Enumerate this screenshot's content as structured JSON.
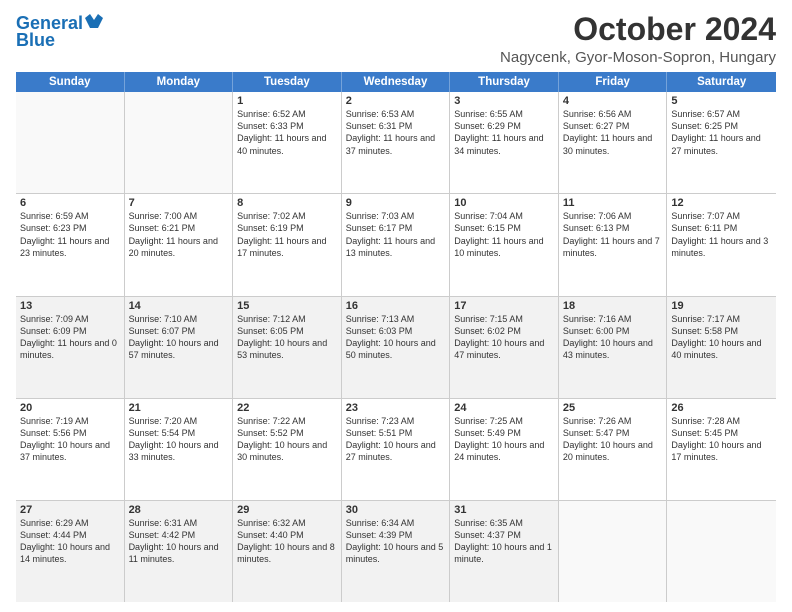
{
  "header": {
    "logo_line1": "General",
    "logo_line2": "Blue",
    "title": "October 2024",
    "subtitle": "Nagycenk, Gyor-Moson-Sopron, Hungary"
  },
  "days_of_week": [
    "Sunday",
    "Monday",
    "Tuesday",
    "Wednesday",
    "Thursday",
    "Friday",
    "Saturday"
  ],
  "weeks": [
    [
      {
        "num": "",
        "text": "",
        "empty": true
      },
      {
        "num": "",
        "text": "",
        "empty": true
      },
      {
        "num": "1",
        "text": "Sunrise: 6:52 AM\nSunset: 6:33 PM\nDaylight: 11 hours and 40 minutes."
      },
      {
        "num": "2",
        "text": "Sunrise: 6:53 AM\nSunset: 6:31 PM\nDaylight: 11 hours and 37 minutes."
      },
      {
        "num": "3",
        "text": "Sunrise: 6:55 AM\nSunset: 6:29 PM\nDaylight: 11 hours and 34 minutes."
      },
      {
        "num": "4",
        "text": "Sunrise: 6:56 AM\nSunset: 6:27 PM\nDaylight: 11 hours and 30 minutes."
      },
      {
        "num": "5",
        "text": "Sunrise: 6:57 AM\nSunset: 6:25 PM\nDaylight: 11 hours and 27 minutes."
      }
    ],
    [
      {
        "num": "6",
        "text": "Sunrise: 6:59 AM\nSunset: 6:23 PM\nDaylight: 11 hours and 23 minutes."
      },
      {
        "num": "7",
        "text": "Sunrise: 7:00 AM\nSunset: 6:21 PM\nDaylight: 11 hours and 20 minutes."
      },
      {
        "num": "8",
        "text": "Sunrise: 7:02 AM\nSunset: 6:19 PM\nDaylight: 11 hours and 17 minutes."
      },
      {
        "num": "9",
        "text": "Sunrise: 7:03 AM\nSunset: 6:17 PM\nDaylight: 11 hours and 13 minutes."
      },
      {
        "num": "10",
        "text": "Sunrise: 7:04 AM\nSunset: 6:15 PM\nDaylight: 11 hours and 10 minutes."
      },
      {
        "num": "11",
        "text": "Sunrise: 7:06 AM\nSunset: 6:13 PM\nDaylight: 11 hours and 7 minutes."
      },
      {
        "num": "12",
        "text": "Sunrise: 7:07 AM\nSunset: 6:11 PM\nDaylight: 11 hours and 3 minutes."
      }
    ],
    [
      {
        "num": "13",
        "text": "Sunrise: 7:09 AM\nSunset: 6:09 PM\nDaylight: 11 hours and 0 minutes.",
        "shaded": true
      },
      {
        "num": "14",
        "text": "Sunrise: 7:10 AM\nSunset: 6:07 PM\nDaylight: 10 hours and 57 minutes.",
        "shaded": true
      },
      {
        "num": "15",
        "text": "Sunrise: 7:12 AM\nSunset: 6:05 PM\nDaylight: 10 hours and 53 minutes.",
        "shaded": true
      },
      {
        "num": "16",
        "text": "Sunrise: 7:13 AM\nSunset: 6:03 PM\nDaylight: 10 hours and 50 minutes.",
        "shaded": true
      },
      {
        "num": "17",
        "text": "Sunrise: 7:15 AM\nSunset: 6:02 PM\nDaylight: 10 hours and 47 minutes.",
        "shaded": true
      },
      {
        "num": "18",
        "text": "Sunrise: 7:16 AM\nSunset: 6:00 PM\nDaylight: 10 hours and 43 minutes.",
        "shaded": true
      },
      {
        "num": "19",
        "text": "Sunrise: 7:17 AM\nSunset: 5:58 PM\nDaylight: 10 hours and 40 minutes.",
        "shaded": true
      }
    ],
    [
      {
        "num": "20",
        "text": "Sunrise: 7:19 AM\nSunset: 5:56 PM\nDaylight: 10 hours and 37 minutes."
      },
      {
        "num": "21",
        "text": "Sunrise: 7:20 AM\nSunset: 5:54 PM\nDaylight: 10 hours and 33 minutes."
      },
      {
        "num": "22",
        "text": "Sunrise: 7:22 AM\nSunset: 5:52 PM\nDaylight: 10 hours and 30 minutes."
      },
      {
        "num": "23",
        "text": "Sunrise: 7:23 AM\nSunset: 5:51 PM\nDaylight: 10 hours and 27 minutes."
      },
      {
        "num": "24",
        "text": "Sunrise: 7:25 AM\nSunset: 5:49 PM\nDaylight: 10 hours and 24 minutes."
      },
      {
        "num": "25",
        "text": "Sunrise: 7:26 AM\nSunset: 5:47 PM\nDaylight: 10 hours and 20 minutes."
      },
      {
        "num": "26",
        "text": "Sunrise: 7:28 AM\nSunset: 5:45 PM\nDaylight: 10 hours and 17 minutes."
      }
    ],
    [
      {
        "num": "27",
        "text": "Sunrise: 6:29 AM\nSunset: 4:44 PM\nDaylight: 10 hours and 14 minutes.",
        "shaded": true
      },
      {
        "num": "28",
        "text": "Sunrise: 6:31 AM\nSunset: 4:42 PM\nDaylight: 10 hours and 11 minutes.",
        "shaded": true
      },
      {
        "num": "29",
        "text": "Sunrise: 6:32 AM\nSunset: 4:40 PM\nDaylight: 10 hours and 8 minutes.",
        "shaded": true
      },
      {
        "num": "30",
        "text": "Sunrise: 6:34 AM\nSunset: 4:39 PM\nDaylight: 10 hours and 5 minutes.",
        "shaded": true
      },
      {
        "num": "31",
        "text": "Sunrise: 6:35 AM\nSunset: 4:37 PM\nDaylight: 10 hours and 1 minute.",
        "shaded": true
      },
      {
        "num": "",
        "text": "",
        "empty": true,
        "shaded": true
      },
      {
        "num": "",
        "text": "",
        "empty": true,
        "shaded": true
      }
    ]
  ]
}
